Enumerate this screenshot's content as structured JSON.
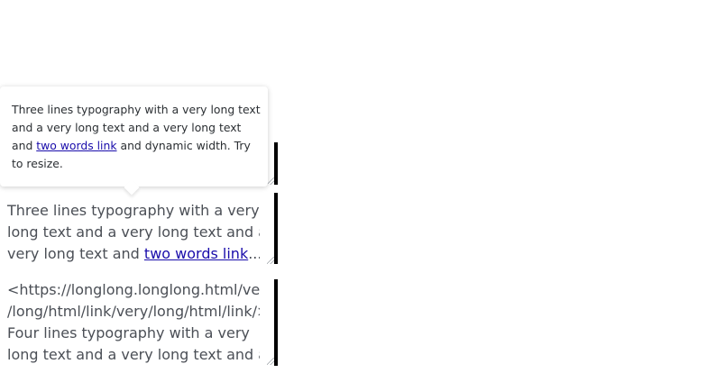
{
  "tooltip": {
    "line1": "Three lines typography with a very long text",
    "line2": "and a very long text and a very long text",
    "line3_pre": "and ",
    "line3_link": "two words link",
    "line3_post": " and dynamic width. Try",
    "line4": "to resize."
  },
  "block2": {
    "line1": "Three lines typography with a very",
    "line2": "long text and a very long text and a",
    "line3_pre": "very long text and ",
    "line3_link": "two words link",
    "ellipsis": "..."
  },
  "block3": {
    "line1": "<https://longlong.longlong.html/very",
    "line2": "/long/html/link/very/long/html/link/>",
    "line3": "Four lines typography with a very",
    "line4": "long text and a very long text and a...",
    "ellipsis": ""
  }
}
